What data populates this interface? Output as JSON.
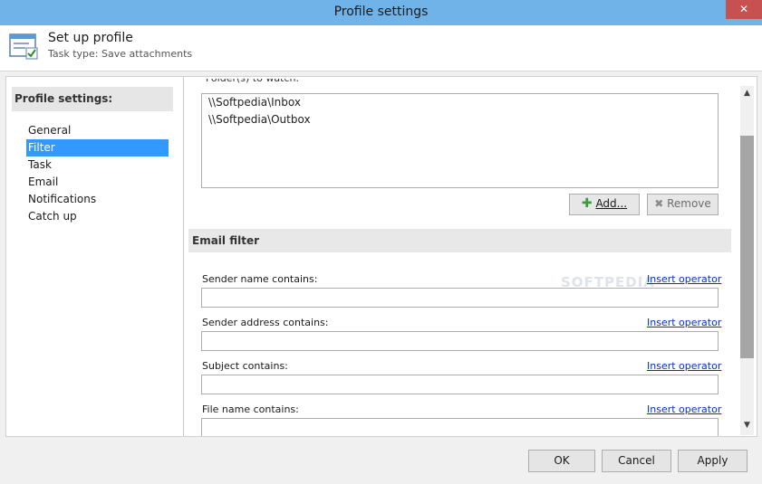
{
  "window": {
    "title": "Profile settings",
    "close_glyph": "✕"
  },
  "header": {
    "title": "Set up profile",
    "subtitle": "Task type: Save attachments",
    "icon": "profile-window-icon"
  },
  "sidebar": {
    "heading": "Profile settings:",
    "items": [
      {
        "label": "General",
        "selected": false
      },
      {
        "label": "Filter",
        "selected": true
      },
      {
        "label": "Task",
        "selected": false
      },
      {
        "label": "Email",
        "selected": false
      },
      {
        "label": "Notifications",
        "selected": false
      },
      {
        "label": "Catch up",
        "selected": false
      }
    ]
  },
  "folders": {
    "label": "Folder(s) to watch:",
    "items": [
      "\\\\Softpedia\\Inbox",
      "\\\\Softpedia\\Outbox"
    ],
    "add_label": "Add...",
    "remove_label": "Remove"
  },
  "email_filter": {
    "heading": "Email filter",
    "insert_label": "Insert operator",
    "fields": [
      {
        "label": "Sender name contains:",
        "value": ""
      },
      {
        "label": "Sender address contains:",
        "value": ""
      },
      {
        "label": "Subject contains:",
        "value": ""
      },
      {
        "label": "File name contains:",
        "value": ""
      }
    ]
  },
  "footer": {
    "ok": "OK",
    "cancel": "Cancel",
    "apply": "Apply"
  },
  "watermark": "SOFTPEDIA",
  "colors": {
    "titlebar": "#6fb3e8",
    "selection": "#3399ff",
    "link": "#0033cc",
    "close": "#c75050"
  }
}
